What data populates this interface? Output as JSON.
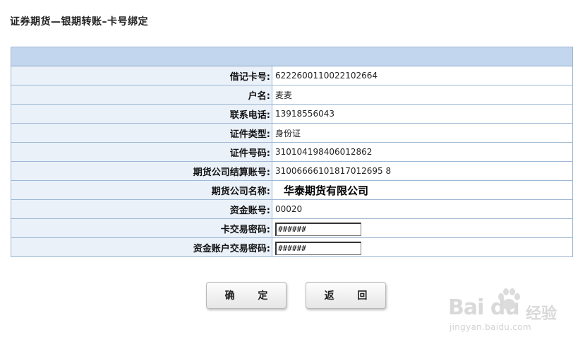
{
  "page": {
    "title": "证券期货—银期转账–卡号绑定"
  },
  "form": {
    "rows": [
      {
        "label": "借记卡号:",
        "value": "6222600110022102664"
      },
      {
        "label": "户名:",
        "value": "麦麦"
      },
      {
        "label": "联系电话:",
        "value": "13918556043"
      },
      {
        "label": "证件类型:",
        "value": "身份证"
      },
      {
        "label": "证件号码:",
        "value": "310104198406012862"
      },
      {
        "label": "期货公司结算账号:",
        "value": "31006666101817012695 8"
      },
      {
        "label": "期货公司名称:",
        "value": "华泰期货有限公司"
      },
      {
        "label": "资金账号:",
        "value": "00020"
      },
      {
        "label": "卡交易密码:",
        "value": "######"
      },
      {
        "label": "资金账户交易密码:",
        "value": "######"
      }
    ]
  },
  "buttons": {
    "confirm": "确 定",
    "back": "返 回"
  },
  "watermark": {
    "logo": "Bai du",
    "jingyan": "经验",
    "url": "jingyan.baidu.com"
  },
  "colors": {
    "header_bg": "#c2d6ed",
    "label_bg": "#eaf1f9",
    "border": "#9fb8d4"
  }
}
